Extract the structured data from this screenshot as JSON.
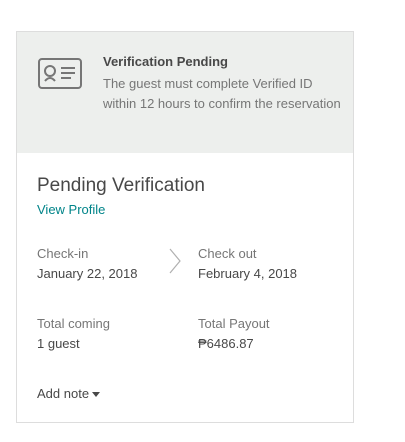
{
  "banner": {
    "icon": "id-card-icon",
    "title": "Verification Pending",
    "text": "The guest must complete Verified ID within 12 hours to confirm the reservation"
  },
  "reservation": {
    "status_title": "Pending Verification",
    "view_profile_label": "View Profile",
    "checkin_label": "Check-in",
    "checkin_date": "January 22, 2018",
    "checkout_label": "Check out",
    "checkout_date": "February 4, 2018",
    "guests_label": "Total coming",
    "guests_value": "1 guest",
    "payout_label": "Total Payout",
    "payout_value": "₱6486.87",
    "add_note_label": "Add note"
  },
  "colors": {
    "banner_bg": "#edefed",
    "link": "#008489",
    "text": "#484848",
    "muted": "#767676"
  }
}
